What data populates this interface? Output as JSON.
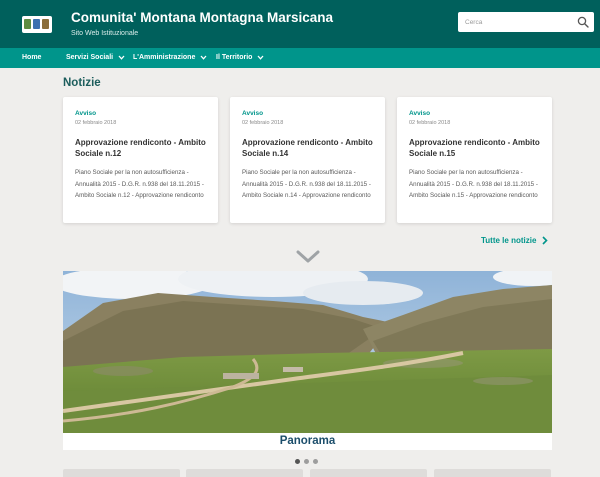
{
  "header": {
    "title": "Comunita' Montana Montagna Marsicana",
    "subtitle": "Sito Web Istituzionale",
    "logo_icon": "municipal-crests-logo"
  },
  "search": {
    "placeholder": "Cerca",
    "icon": "search-icon"
  },
  "nav": {
    "items": [
      {
        "label": "Home",
        "has_dropdown": false
      },
      {
        "label": "Servizi Sociali",
        "has_dropdown": true
      },
      {
        "label": "L'Amministrazione",
        "has_dropdown": true
      },
      {
        "label": "Il Territorio",
        "has_dropdown": true
      }
    ]
  },
  "news": {
    "section_title": "Notizie",
    "cards": [
      {
        "category": "Avviso",
        "date": "02 febbraio 2018",
        "title": "Approvazione rendiconto - Ambito Sociale n.12",
        "description": "Piano Sociale per la non autosufficienza - Annualità 2015 - D.G.R. n.938 del 18.11.2015 - Ambito Sociale n.12 - Approvazione rendiconto"
      },
      {
        "category": "Avviso",
        "date": "02 febbraio 2018",
        "title": "Approvazione rendiconto - Ambito Sociale n.14",
        "description": "Piano Sociale per la non autosufficienza - Annualità 2015 - D.G.R. n.938 del 18.11.2015 - Ambito Sociale n.14 - Approvazione rendiconto"
      },
      {
        "category": "Avviso",
        "date": "02 febbraio 2018",
        "title": "Approvazione rendiconto - Ambito Sociale n.15",
        "description": "Piano Sociale per la non autosufficienza - Annualità 2015 - D.G.R. n.938 del 18.11.2015 - Ambito Sociale n.15 - Approvazione rendiconto"
      }
    ],
    "all_news_label": "Tutte le notizie"
  },
  "gallery": {
    "caption": "Panorama",
    "dot_count": 3,
    "active_index": 0
  },
  "colors": {
    "header_bg": "#00605c",
    "nav_bg": "#00958b",
    "accent": "#00958b",
    "section_title": "#1c5d5c",
    "caption": "#1c4e6b",
    "page_bg": "#efeeec"
  }
}
